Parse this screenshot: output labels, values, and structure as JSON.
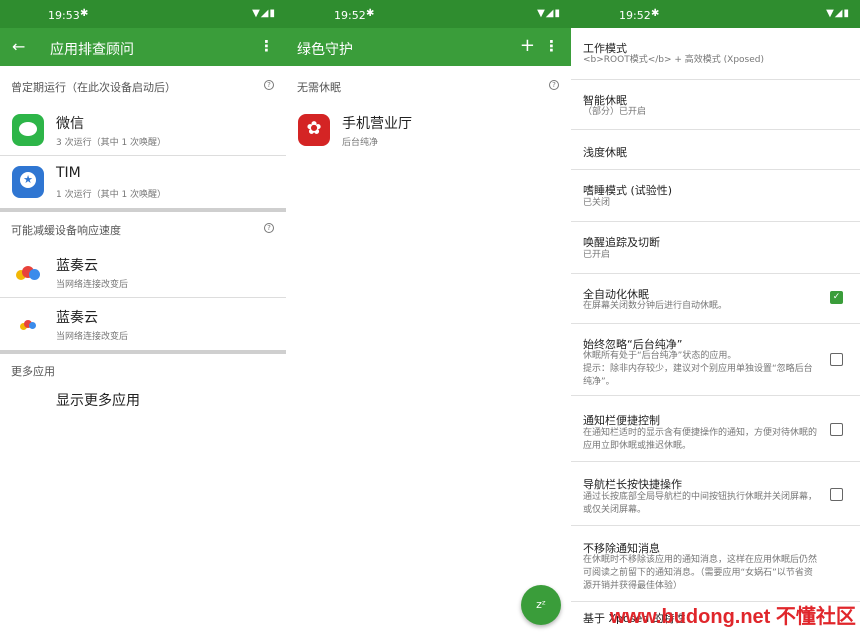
{
  "screen1": {
    "time": "19:53",
    "title": "应用排查顾问",
    "section1": "曾定期运行（在此次设备启动后）",
    "apps1": [
      {
        "name": "微信",
        "sub": "3 次运行（其中 1 次唤醒）"
      },
      {
        "name": "TIM",
        "sub": "1 次运行（其中 1 次唤醒）"
      }
    ],
    "section2": "可能减缓设备响应速度",
    "apps2": [
      {
        "name": "蓝奏云",
        "sub": "当网络连接改变后"
      },
      {
        "name": "蓝奏云",
        "sub": "当网络连接改变后"
      }
    ],
    "section3": "更多应用",
    "more_link": "显示更多应用"
  },
  "screen2": {
    "time": "19:52",
    "title": "绿色守护",
    "section": "无需休眠",
    "app": {
      "name": "手机营业厅",
      "sub": "后台纯净"
    },
    "fab": "zᶻ"
  },
  "screen3": {
    "time": "19:52",
    "settings": [
      {
        "title": "工作模式",
        "desc": "<b>ROOT模式</b> + 高效模式 (Xposed)"
      },
      {
        "title": "智能休眠",
        "desc": "（部分）已开启"
      },
      {
        "title": "浅度休眠",
        "desc": ""
      },
      {
        "title": "嗜睡模式 (试验性)",
        "desc": "已关闭"
      },
      {
        "title": "唤醒追踪及切断",
        "desc": "已开启"
      },
      {
        "title": "全自动化休眠",
        "desc": "在屏幕关闭数分钟后进行自动休眠。",
        "checked": true
      },
      {
        "title": "始终忽略“后台纯净”",
        "desc": "休眠所有处于“后台纯净”状态的应用。\n提示：除非内存较少，建议对个别应用单独设置“忽略后台纯净”。",
        "checked": false
      },
      {
        "title": "通知栏便捷控制",
        "desc": "在通知栏适时的显示含有便捷操作的通知，方便对待休眠的应用立即休眠或推迟休眠。",
        "checked": false
      },
      {
        "title": "导航栏长按快捷操作",
        "desc": "通过长按底部全局导航栏的中间按钮执行休眠并关闭屏幕，或仅关闭屏幕。",
        "checked": false
      },
      {
        "title": "不移除通知消息",
        "desc": "在休眠时不移除该应用的通知消息，这样在应用休眠后仍然可阅读之前留下的通知消息。（需要应用“女娲石”以节省资源开销并获得最佳体验）"
      },
      {
        "title": "基于 Xposed 的特性",
        "desc": ""
      }
    ]
  },
  "watermark": "www.budong.net 不懂社区",
  "colors": {
    "statusbar": "#2f8d2f",
    "appbar": "#3a9d3a",
    "accent": "#3a9d3a"
  }
}
